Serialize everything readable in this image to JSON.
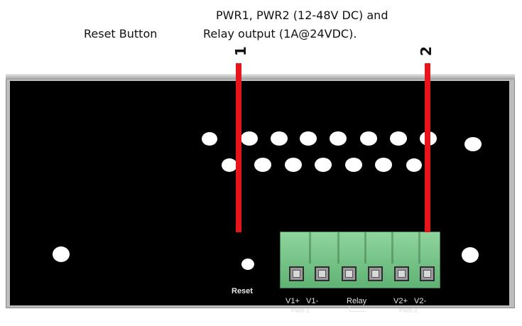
{
  "callouts": {
    "reset": "Reset Button",
    "power_line1": "PWR1, PWR2 (12-48V DC) and",
    "power_line2": "Relay output (1A@24VDC)."
  },
  "markers": {
    "one": "1",
    "two": "2"
  },
  "panel": {
    "reset_label": "Reset",
    "terminals": {
      "v1_plus": "V1+",
      "v1_minus": "V1-",
      "relay": "Relay",
      "v2_plus": "V2+",
      "v2_minus": "V2-"
    },
    "groups": {
      "pwr1": "PWR-1",
      "pwr2": "PWR-2"
    }
  },
  "colors": {
    "panel": "#000000",
    "callout_line": "#e8141c",
    "terminal_block": "#6fc184"
  }
}
